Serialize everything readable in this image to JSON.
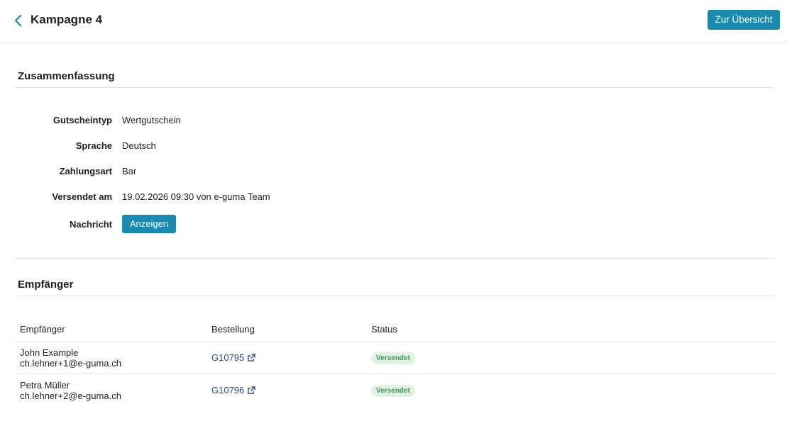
{
  "header": {
    "title": "Kampagne 4",
    "overview_button": "Zur Übersicht"
  },
  "summary": {
    "title": "Zusammenfassung",
    "rows": [
      {
        "label": "Gutscheintyp",
        "value": "Wertgutschein"
      },
      {
        "label": "Sprache",
        "value": "Deutsch"
      },
      {
        "label": "Zahlungsart",
        "value": "Bar"
      },
      {
        "label": "Versendet am",
        "value": "19.02.2026 09:30 von e-guma Team"
      }
    ],
    "message_label": "Nachricht",
    "message_button": "Anzeigen"
  },
  "recipients": {
    "title": "Empfänger",
    "columns": [
      "Empfänger",
      "Bestellung",
      "Status"
    ],
    "rows": [
      {
        "name": "John Example",
        "email": "ch.lehner+1@e-guma.ch",
        "order": "G10795",
        "status": "Versendet"
      },
      {
        "name": "Petra Müller",
        "email": "ch.lehner+2@e-guma.ch",
        "order": "G10796",
        "status": "Versendet"
      }
    ]
  },
  "colors": {
    "accent": "#1b8ab0",
    "link": "#2b4a8c",
    "status_bg": "#dff2e3",
    "status_text": "#3f9a55"
  },
  "icons": {
    "back": "chevron-left-icon",
    "order_link": "external-link-icon"
  }
}
